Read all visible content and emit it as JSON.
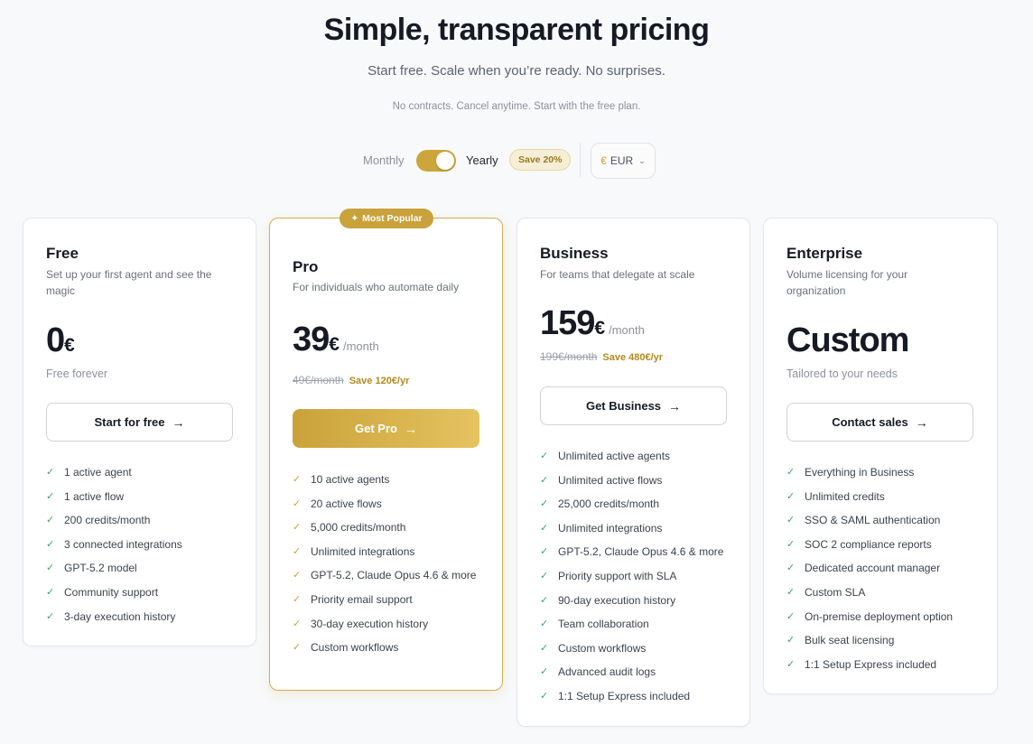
{
  "header": {
    "title": "Simple, transparent pricing",
    "subtitle": "Start free. Scale when you’re ready. No surprises.",
    "note": "No contracts. Cancel anytime. Start with the free plan."
  },
  "billing": {
    "monthly_label": "Monthly",
    "yearly_label": "Yearly",
    "toggle_state": "yearly",
    "save_badge": "Save 20%",
    "currency_symbol": "€",
    "currency_code": "EUR",
    "accent_color": "#cca63a"
  },
  "plans": [
    {
      "name": "Free",
      "description": "Set up your first agent and see the magic",
      "price": "0",
      "currency": "€",
      "price_note": "Free forever",
      "button_label": "Start for free",
      "features": [
        "1 active agent",
        "1 active flow",
        "200 credits/month",
        "3 connected integrations",
        "GPT-5.2 model",
        "Community support",
        "3-day execution history"
      ]
    },
    {
      "name": "Pro",
      "badge": "Most Popular",
      "description": "For individuals who automate daily",
      "price": "39",
      "currency": "€",
      "period": "/month",
      "old_price": "49€/month",
      "saving": "Save 120€/yr",
      "button_label": "Get Pro",
      "features": [
        "10 active agents",
        "20 active flows",
        "5,000 credits/month",
        "Unlimited integrations",
        "GPT-5.2, Claude Opus 4.6 & more",
        "Priority email support",
        "30-day execution history",
        "Custom workflows"
      ]
    },
    {
      "name": "Business",
      "description": "For teams that delegate at scale",
      "price": "159",
      "currency": "€",
      "period": "/month",
      "old_price": "199€/month",
      "saving": "Save 480€/yr",
      "button_label": "Get Business",
      "features": [
        "Unlimited active agents",
        "Unlimited active flows",
        "25,000 credits/month",
        "Unlimited integrations",
        "GPT-5.2, Claude Opus 4.6 & more",
        "Priority support with SLA",
        "90-day execution history",
        "Team collaboration",
        "Custom workflows",
        "Advanced audit logs",
        "1:1 Setup Express included"
      ]
    },
    {
      "name": "Enterprise",
      "description": "Volume licensing for your organization",
      "price": "Custom",
      "price_note": "Tailored to your needs",
      "button_label": "Contact sales",
      "features": [
        "Everything in Business",
        "Unlimited credits",
        "SSO & SAML authentication",
        "SOC 2 compliance reports",
        "Dedicated account manager",
        "Custom SLA",
        "On-premise deployment option",
        "Bulk seat licensing",
        "1:1 Setup Express included"
      ]
    }
  ]
}
